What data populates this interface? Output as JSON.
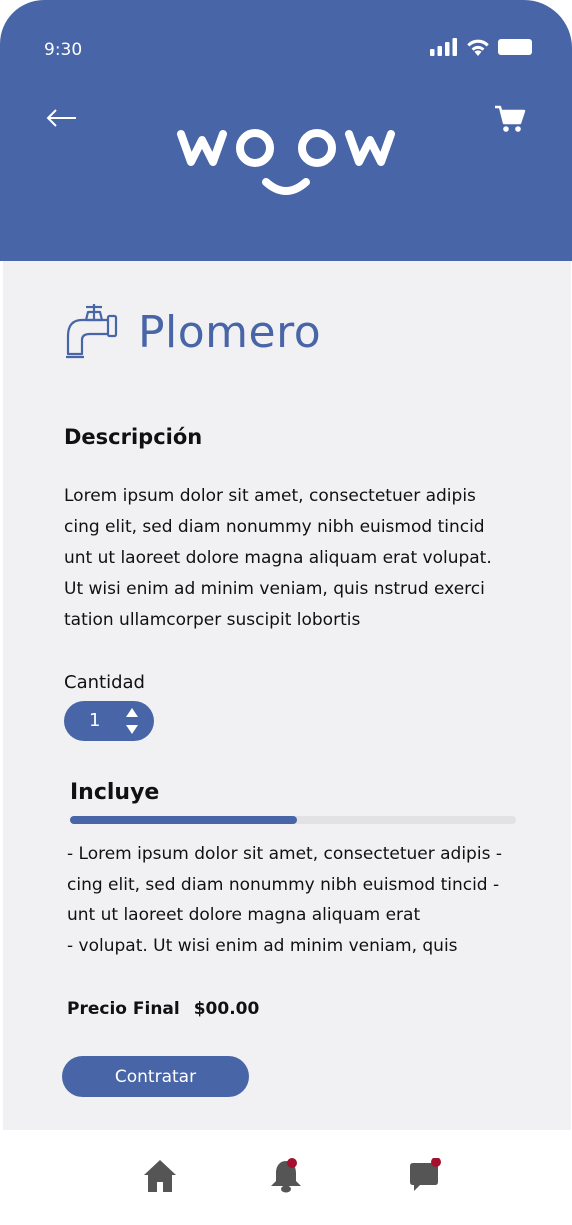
{
  "status_bar": {
    "time": "9:30"
  },
  "header": {
    "brand": "woow"
  },
  "service": {
    "title": "Plomero"
  },
  "description": {
    "heading": "Descripción",
    "lines": [
      "Lorem ipsum dolor sit amet, consectetuer adipis",
      "cing elit, sed diam nonummy nibh euismod tincid",
      "unt ut laoreet dolore magna aliquam erat volupat.",
      "Ut wisi enim ad minim veniam, quis nstrud exerci",
      "tation ullamcorper suscipit lobortis"
    ]
  },
  "quantity": {
    "label": "Cantidad",
    "value": "1"
  },
  "includes": {
    "heading": "Incluye",
    "progress": 0.51,
    "items": [
      "- Lorem ipsum dolor sit amet, consectetuer adipis -",
      "cing elit, sed diam nonummy nibh euismod tincid -",
      "unt ut laoreet dolore magna aliquam erat",
      "- volupat. Ut wisi enim ad minim veniam, quis"
    ]
  },
  "price": {
    "label": "Precio Final",
    "value": "$00.00"
  },
  "actions": {
    "hire_label": "Contratar"
  },
  "nav": {
    "items": [
      {
        "icon": "home-icon",
        "badge": false
      },
      {
        "icon": "bell-icon",
        "badge": true
      },
      {
        "icon": "chat-icon",
        "badge": true
      }
    ]
  },
  "colors": {
    "primary": "#4865a7",
    "background": "#f1f1f3",
    "badge": "#a3112e"
  }
}
